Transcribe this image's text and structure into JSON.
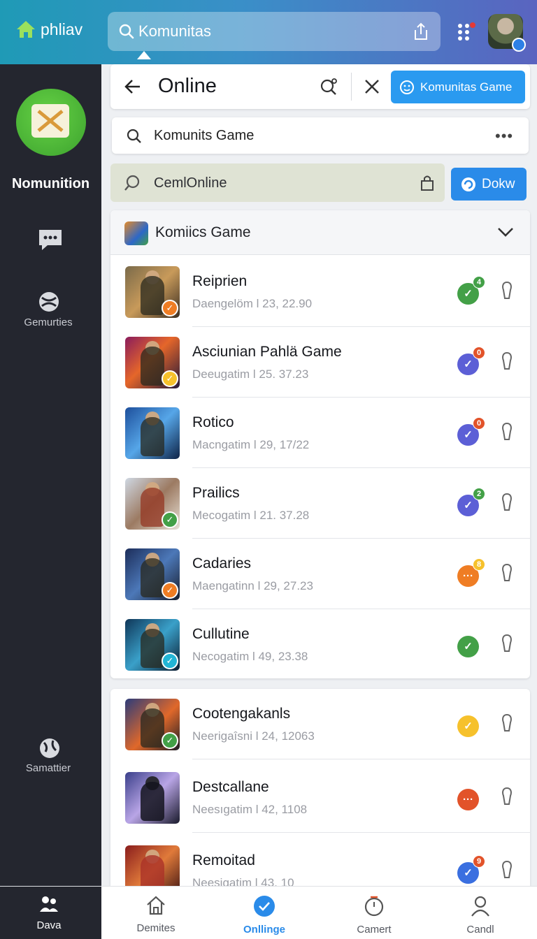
{
  "topbar": {
    "brand": "phliav",
    "search_text": "Komunitas"
  },
  "sidebar": {
    "title": "Nomunition",
    "label_1": "Gemurties",
    "label_2": "Samattier"
  },
  "header": {
    "title": "Online",
    "komunitas_button": "Komunitas Game"
  },
  "search": {
    "value": "Komunits Game",
    "more": "•••"
  },
  "filter": {
    "value": "CemlOnline",
    "action_button": "Dokw"
  },
  "group": {
    "title": "Komiics Game"
  },
  "colors": {
    "accent": "#2a8be9",
    "sidebar": "#24262f",
    "green": "#43a047",
    "purple": "#5c5fd6",
    "orange": "#ef7d24",
    "red": "#e2532a",
    "yellow": "#f6c12c"
  },
  "rows": [
    {
      "name": "Reiprien",
      "meta": "Daengelöm l 23, 22.90",
      "status": "green",
      "count": "4"
    },
    {
      "name": "Asciunian Pahlä Game",
      "meta": "Deeugatim l 25. 37.23",
      "status": "purple",
      "count": "0"
    },
    {
      "name": "Rotico",
      "meta": "Macngatim l 29, 17/22",
      "status": "purple",
      "count": "0"
    },
    {
      "name": "Prailics",
      "meta": "Mecogatim l 21. 37.28",
      "status": "purple",
      "count": "2"
    },
    {
      "name": "Cadaries",
      "meta": "Maengatinn l 29, 27.23",
      "status": "orange",
      "count": "8"
    },
    {
      "name": "Cullutine",
      "meta": "Necogatim l 49, 23.38",
      "status": "green",
      "count": ""
    },
    {
      "name": "Cootengakanls",
      "meta": "Neerigaîsni l 24, 12063",
      "status": "yellow",
      "count": ""
    },
    {
      "name": "Destcallane",
      "meta": "Neesıgatim l 42, 1108",
      "status": "red",
      "count": ""
    },
    {
      "name": "Remoitad",
      "meta": "Neesigatim l 43, 10",
      "status": "purple",
      "count": "9"
    }
  ],
  "bottom_nav": [
    {
      "label": "Dava"
    },
    {
      "label": "Demites"
    },
    {
      "label": "Onllinge"
    },
    {
      "label": "Camert"
    },
    {
      "label": "Candl"
    }
  ]
}
